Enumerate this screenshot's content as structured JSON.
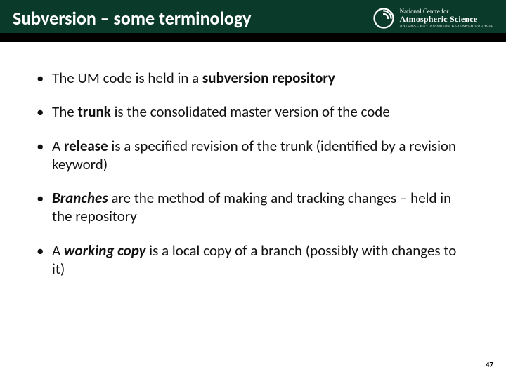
{
  "header": {
    "title": "Subversion – some terminology",
    "logo": {
      "line1": "National Centre for",
      "line2": "Atmospheric Science",
      "line3": "NATURAL ENVIRONMENT RESEARCH COUNCIL"
    }
  },
  "bullets": [
    {
      "pre": "The UM code is held in a ",
      "bold": "subversion repository",
      "post": ""
    },
    {
      "pre": "The ",
      "bold": "trunk",
      "post": " is the consolidated master version of the code"
    },
    {
      "pre": "A ",
      "bold": "release",
      "post": " is a specified revision of the trunk (identified by a revision keyword)"
    },
    {
      "pre": "",
      "bold": "Branches",
      "post": " are the method of making and tracking changes – held in the repository",
      "italic": true
    },
    {
      "pre": "A ",
      "bold": "working copy",
      "post": " is a local copy of a branch (possibly with changes to it)",
      "italic": true
    }
  ],
  "page_number": "47"
}
